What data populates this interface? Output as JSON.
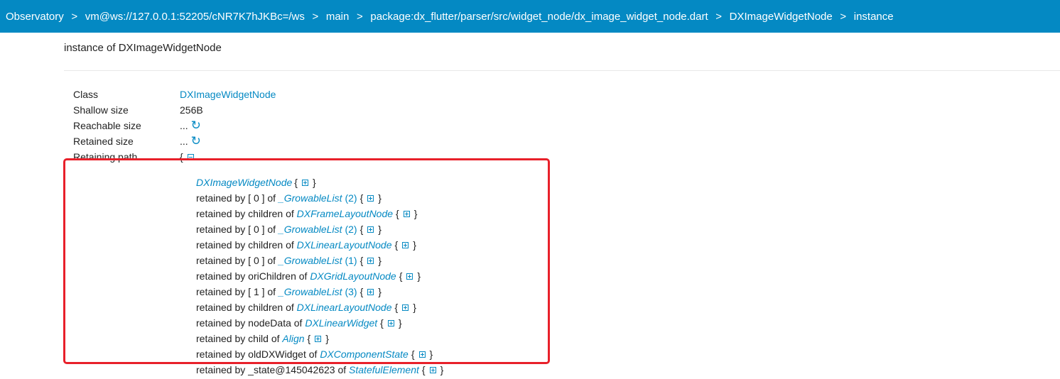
{
  "breadcrumbs": [
    "Observatory",
    "vm@ws://127.0.0.1:52205/cNR7K7hJKBc=/ws",
    "main",
    "package:dx_flutter/parser/src/widget_node/dx_image_widget_node.dart",
    "DXImageWidgetNode",
    "instance"
  ],
  "breadcrumb_separator": ">",
  "page_title": "instance of DXImageWidgetNode",
  "fields": {
    "class": {
      "label": "Class",
      "value": "DXImageWidgetNode"
    },
    "shallow_size": {
      "label": "Shallow size",
      "value": "256B"
    },
    "reachable_size": {
      "label": "Reachable size",
      "value": "..."
    },
    "retained_size": {
      "label": "Retained size",
      "value": "..."
    },
    "retaining_path": {
      "label": "Retaining path",
      "open": "{"
    }
  },
  "retaining_path": {
    "root": {
      "class": "DXImageWidgetNode",
      "open": "{",
      "close": "}"
    },
    "entries": [
      {
        "prefix": "retained by [ 0 ] of ",
        "class": "_GrowableList",
        "count": "(2)"
      },
      {
        "prefix": "retained by children of ",
        "class": "DXFrameLayoutNode",
        "count": ""
      },
      {
        "prefix": "retained by [ 0 ] of ",
        "class": "_GrowableList",
        "count": "(2)"
      },
      {
        "prefix": "retained by children of ",
        "class": "DXLinearLayoutNode",
        "count": ""
      },
      {
        "prefix": "retained by [ 0 ] of ",
        "class": "_GrowableList",
        "count": "(1)"
      },
      {
        "prefix": "retained by oriChildren of ",
        "class": "DXGridLayoutNode",
        "count": ""
      },
      {
        "prefix": "retained by [ 1 ] of ",
        "class": "_GrowableList",
        "count": "(3)"
      },
      {
        "prefix": "retained by children of ",
        "class": "DXLinearLayoutNode",
        "count": ""
      },
      {
        "prefix": "retained by nodeData of ",
        "class": "DXLinearWidget",
        "count": ""
      },
      {
        "prefix": "retained by child of ",
        "class": "Align",
        "count": ""
      },
      {
        "prefix": "retained by oldDXWidget of ",
        "class": "DXComponentState",
        "count": ""
      },
      {
        "prefix": "retained by _state@145042623 of ",
        "class": "StatefulElement",
        "count": ""
      }
    ],
    "brace_open": "{",
    "brace_close": "}"
  },
  "colors": {
    "navbar": "#0489c3",
    "link": "#0489c3",
    "highlight": "#e8202a"
  },
  "icons": {
    "refresh": "refresh-icon",
    "collapse": "collapse-icon",
    "expand": "expand-icon"
  }
}
